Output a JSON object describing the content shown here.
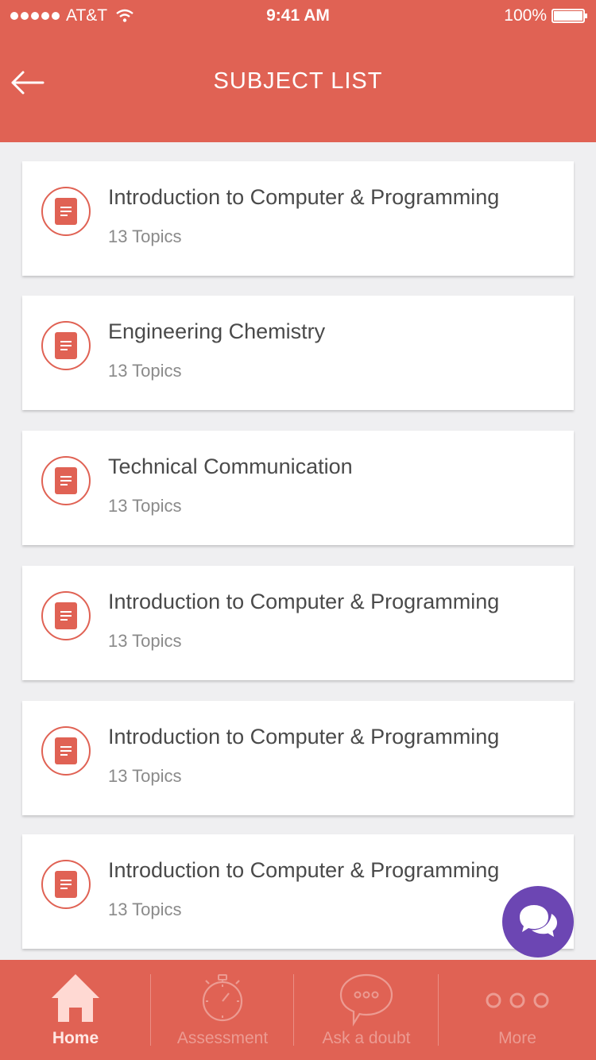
{
  "status_bar": {
    "carrier": "AT&T",
    "time": "9:41 AM",
    "battery": "100%"
  },
  "header": {
    "title": "SUBJECT LIST",
    "back_icon": "arrow-left-icon"
  },
  "subjects": [
    {
      "title": "Introduction to Computer & Programming",
      "topics": "13 Topics",
      "icon": "document-icon"
    },
    {
      "title": "Engineering Chemistry",
      "topics": "13 Topics",
      "icon": "document-icon"
    },
    {
      "title": "Technical Communication",
      "topics": "13 Topics",
      "icon": "document-icon"
    },
    {
      "title": "Introduction to Computer & Programming",
      "topics": "13 Topics",
      "icon": "document-icon"
    },
    {
      "title": "Introduction to Computer & Programming",
      "topics": "13 Topics",
      "icon": "document-icon"
    },
    {
      "title": "Introduction to Computer & Programming",
      "topics": "13 Topics",
      "icon": "document-icon"
    }
  ],
  "chat_fab": {
    "icon": "chat-bubbles-icon"
  },
  "tabbar": {
    "active": "Home",
    "tabs": [
      {
        "label": "Home",
        "icon": "home-icon"
      },
      {
        "label": "Assessment",
        "icon": "stopwatch-icon"
      },
      {
        "label": "Ask a doubt",
        "icon": "speech-bubble-icon"
      },
      {
        "label": "More",
        "icon": "more-dots-icon"
      }
    ]
  },
  "colors": {
    "primary": "#e06254",
    "background": "#efeff1",
    "fab": "#6c46b3"
  }
}
